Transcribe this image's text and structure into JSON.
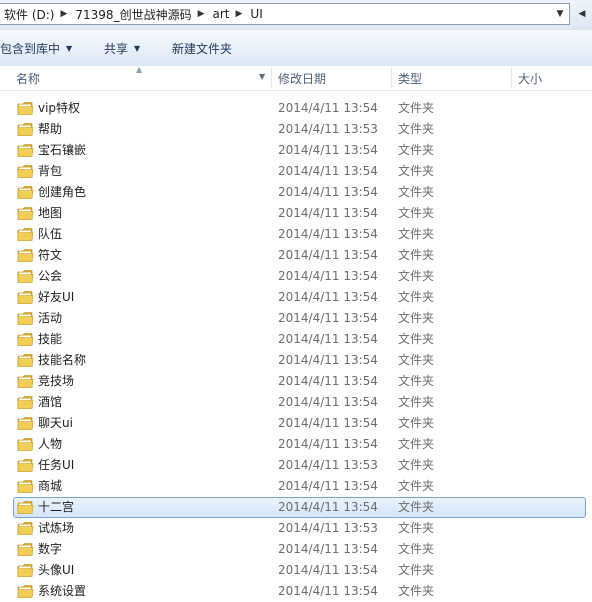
{
  "address": {
    "crumbs": [
      "软件 (D:)",
      "71398_创世战神源码",
      "art",
      "UI"
    ]
  },
  "toolbar": {
    "include_library": "包含到库中",
    "share": "共享",
    "new_folder": "新建文件夹"
  },
  "columns": {
    "name": "名称",
    "date": "修改日期",
    "type": "类型",
    "size": "大小"
  },
  "colors": {
    "selection_border": "#7da2ce",
    "folder_yellow": "#f1c84b"
  },
  "files": [
    {
      "name": "vip特权",
      "date": "2014/4/11 13:54",
      "type": "文件夹"
    },
    {
      "name": "帮助",
      "date": "2014/4/11 13:53",
      "type": "文件夹"
    },
    {
      "name": "宝石镶嵌",
      "date": "2014/4/11 13:54",
      "type": "文件夹"
    },
    {
      "name": "背包",
      "date": "2014/4/11 13:54",
      "type": "文件夹"
    },
    {
      "name": "创建角色",
      "date": "2014/4/11 13:54",
      "type": "文件夹"
    },
    {
      "name": "地图",
      "date": "2014/4/11 13:54",
      "type": "文件夹"
    },
    {
      "name": "队伍",
      "date": "2014/4/11 13:54",
      "type": "文件夹"
    },
    {
      "name": "符文",
      "date": "2014/4/11 13:54",
      "type": "文件夹"
    },
    {
      "name": "公会",
      "date": "2014/4/11 13:54",
      "type": "文件夹"
    },
    {
      "name": "好友UI",
      "date": "2014/4/11 13:54",
      "type": "文件夹"
    },
    {
      "name": "活动",
      "date": "2014/4/11 13:54",
      "type": "文件夹"
    },
    {
      "name": "技能",
      "date": "2014/4/11 13:54",
      "type": "文件夹"
    },
    {
      "name": "技能名称",
      "date": "2014/4/11 13:54",
      "type": "文件夹"
    },
    {
      "name": "竞技场",
      "date": "2014/4/11 13:54",
      "type": "文件夹"
    },
    {
      "name": "酒馆",
      "date": "2014/4/11 13:54",
      "type": "文件夹"
    },
    {
      "name": "聊天ui",
      "date": "2014/4/11 13:54",
      "type": "文件夹"
    },
    {
      "name": "人物",
      "date": "2014/4/11 13:54",
      "type": "文件夹"
    },
    {
      "name": "任务UI",
      "date": "2014/4/11 13:53",
      "type": "文件夹"
    },
    {
      "name": "商城",
      "date": "2014/4/11 13:54",
      "type": "文件夹"
    },
    {
      "name": "十二宫",
      "date": "2014/4/11 13:54",
      "type": "文件夹",
      "selected": true
    },
    {
      "name": "试炼场",
      "date": "2014/4/11 13:53",
      "type": "文件夹"
    },
    {
      "name": "数字",
      "date": "2014/4/11 13:54",
      "type": "文件夹"
    },
    {
      "name": "头像UI",
      "date": "2014/4/11 13:54",
      "type": "文件夹"
    },
    {
      "name": "系统设置",
      "date": "2014/4/11 13:54",
      "type": "文件夹"
    }
  ]
}
